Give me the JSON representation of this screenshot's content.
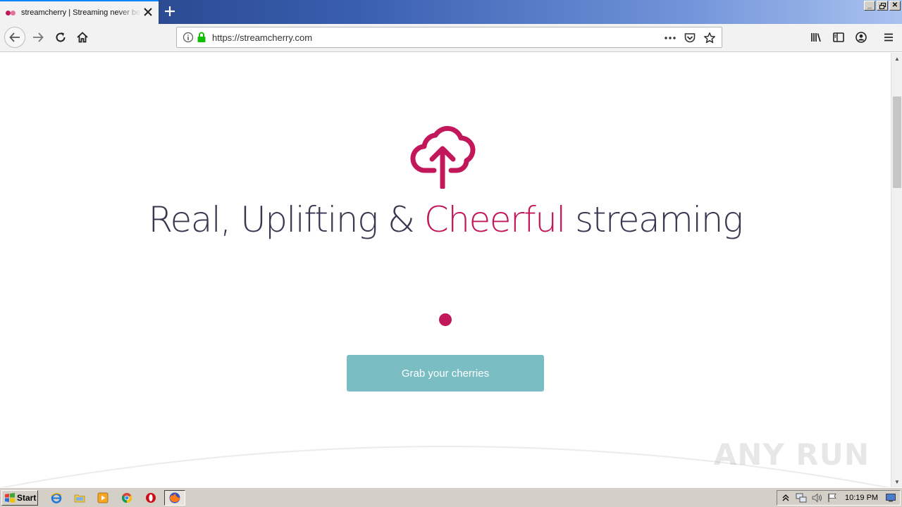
{
  "browser": {
    "tab": {
      "title": "streamcherry | Streaming never be"
    },
    "url": "https://streamcherry.com"
  },
  "icons": {
    "tab_favicon": "streamcherry-favicon",
    "tab_close": "close-icon",
    "new_tab": "plus-icon",
    "back": "arrow-left-icon",
    "forward": "arrow-right-icon",
    "reload": "reload-icon",
    "home": "home-icon",
    "site_info": "info-icon",
    "secure": "lock-icon",
    "page_actions": "more-icon",
    "pocket": "pocket-icon",
    "bookmark": "star-icon",
    "library": "library-icon",
    "sidebar": "sidebar-icon",
    "account": "account-icon",
    "menu": "hamburger-menu-icon",
    "hero": "cloud-upload-icon"
  },
  "page": {
    "headline_part1": "Real, Uplifting & ",
    "headline_accent": "Cheerful",
    "headline_part2": " streaming",
    "cta_label": "Grab your cherries",
    "watermark": "ANY RUN"
  },
  "colors": {
    "accent": "#c2185b",
    "headline": "#3b3650",
    "cta_background": "#7abec4",
    "cta_text": "#ffffff"
  },
  "taskbar": {
    "start_label": "Start",
    "quick_launch": [
      "internet-explorer-icon",
      "folder-icon",
      "media-player-icon",
      "chrome-icon",
      "opera-icon",
      "firefox-icon"
    ],
    "tray_icons": [
      "tray-expand-icon",
      "network-icon",
      "volume-icon",
      "flag-icon"
    ],
    "clock": "10:19 PM"
  }
}
